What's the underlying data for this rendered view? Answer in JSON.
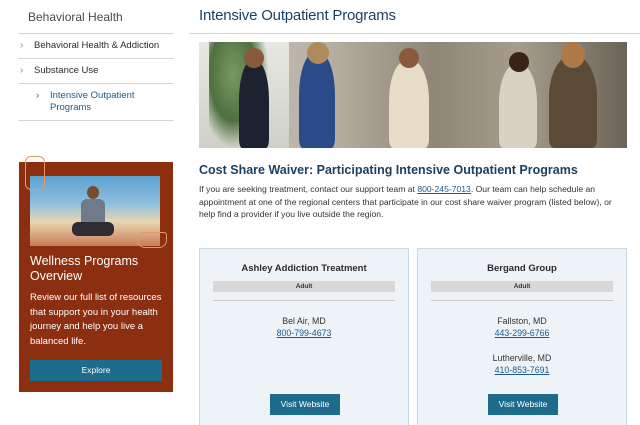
{
  "sidebar": {
    "title": "Behavioral Health",
    "items": [
      {
        "label": "Behavioral Health & Addiction"
      },
      {
        "label": "Substance Use"
      }
    ],
    "subitem": {
      "label": "Intensive Outpatient Programs"
    }
  },
  "wellness": {
    "title": "Wellness Programs Overview",
    "text": "Review our full list of resources that support you in your health journey and help you live a balanced life.",
    "button": "Explore"
  },
  "main": {
    "title": "Intensive Outpatient Programs",
    "heading": "Cost Share Waiver: Participating Intensive Outpatient Programs",
    "intro_before": "If you are seeking treatment, contact our support team at ",
    "intro_phone": "800-245-7013",
    "intro_after": ". Our team can help schedule an appointment at one of the regional centers that participate in our cost share waiver program (listed below), or help find a provider if you live outside the region."
  },
  "programs": [
    {
      "name": "Ashley Addiction Treatment",
      "badge": "Adult",
      "locations": [
        {
          "city": "Bel Air, MD",
          "phone": "800-799-4673"
        }
      ],
      "button": "Visit Website"
    },
    {
      "name": "Bergand Group",
      "badge": "Adult",
      "locations": [
        {
          "city": "Fallston, MD",
          "phone": "443-299-6766"
        },
        {
          "city": "Lutherville, MD",
          "phone": "410-853-7691"
        }
      ],
      "button": "Visit Website"
    }
  ],
  "colors": {
    "brand_blue": "#1c3f5e",
    "link_blue": "#1e5a85",
    "button_teal": "#1e6c8c",
    "wellness_bg": "#8b2f10",
    "card_bg": "#eef3f8"
  }
}
